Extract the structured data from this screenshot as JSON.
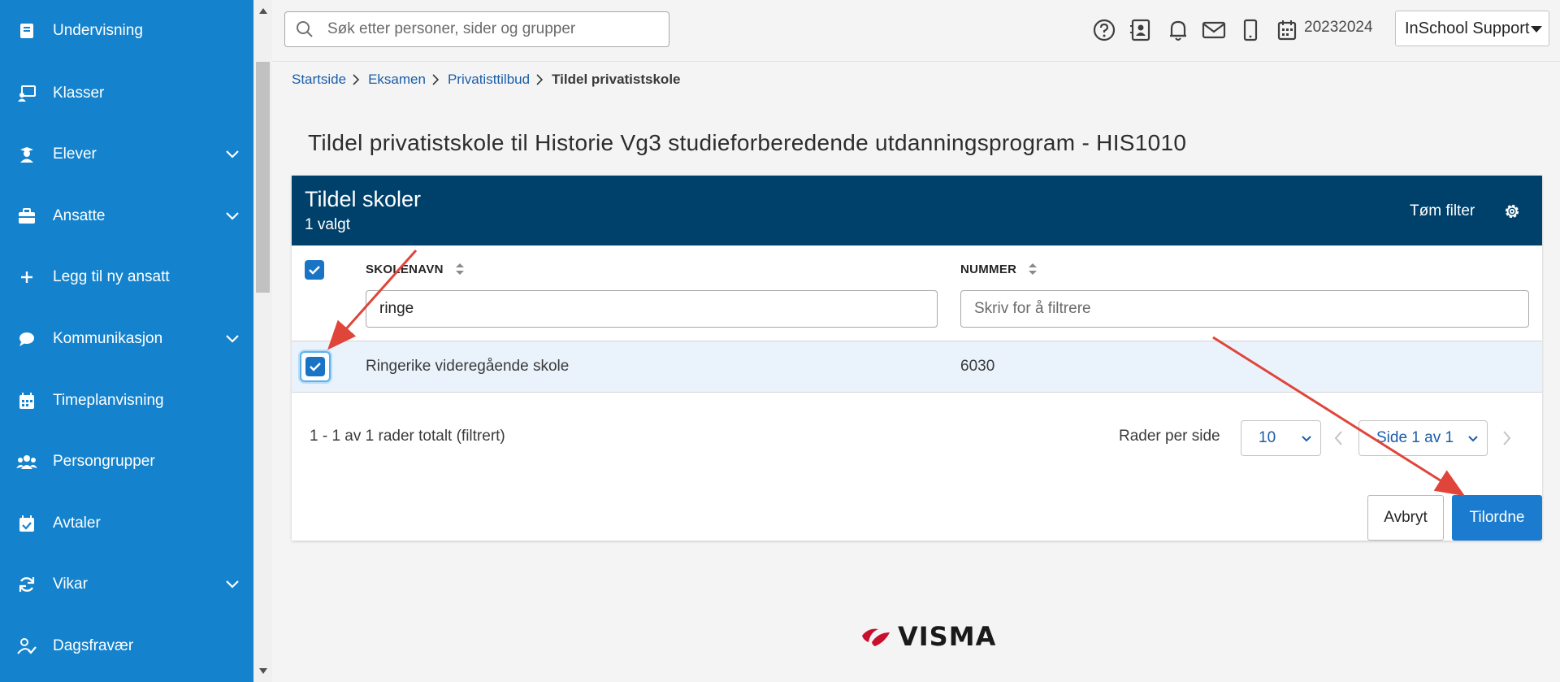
{
  "sidebar": {
    "items": [
      {
        "label": "Undervisning",
        "icon": "book-icon",
        "expandable": false
      },
      {
        "label": "Klasser",
        "icon": "teacher-board-icon",
        "expandable": false
      },
      {
        "label": "Elever",
        "icon": "student-icon",
        "expandable": true
      },
      {
        "label": "Ansatte",
        "icon": "briefcase-icon",
        "expandable": true
      },
      {
        "label": "Legg til ny ansatt",
        "icon": "plus-icon",
        "expandable": false
      },
      {
        "label": "Kommunikasjon",
        "icon": "chat-bubble-icon",
        "expandable": true
      },
      {
        "label": "Timeplanvisning",
        "icon": "calendar-icon",
        "expandable": false
      },
      {
        "label": "Persongrupper",
        "icon": "group-icon",
        "expandable": false
      },
      {
        "label": "Avtaler",
        "icon": "calendar-check-icon",
        "expandable": false
      },
      {
        "label": "Vikar",
        "icon": "refresh-icon",
        "expandable": true
      },
      {
        "label": "Dagsfravær",
        "icon": "user-check-icon",
        "expandable": false
      }
    ],
    "bg_color": "#1482cc"
  },
  "topbar": {
    "search_placeholder": "Søk etter personer, sider og grupper",
    "school_year": "20232024",
    "user_menu": "InSchool Support"
  },
  "breadcrumb": {
    "items": [
      "Startside",
      "Eksamen",
      "Privatisttilbud"
    ],
    "current": "Tildel privatistskole"
  },
  "page": {
    "title": "Tildel privatistskole til Historie Vg3 studieforberedende utdanningsprogram - HIS1010"
  },
  "card": {
    "title": "Tildel skoler",
    "subtitle": "1 valgt",
    "clear_filter": "Tøm filter",
    "header_color": "#00416b",
    "columns": [
      {
        "label": "SKOLENAVN",
        "filter_value": "ringe",
        "filter_placeholder": ""
      },
      {
        "label": "NUMMER",
        "filter_value": "",
        "filter_placeholder": "Skriv for å filtrere"
      }
    ],
    "rows": [
      {
        "school_name": "Ringerike videregående skole",
        "number": "6030",
        "checked": true
      }
    ],
    "summary": "1 - 1 av 1 rader totalt (filtrert)",
    "rows_per_page_label": "Rader per side",
    "rows_per_page": "10",
    "page_select": "Side 1 av 1",
    "cancel_label": "Avbryt",
    "assign_label": "Tilordne",
    "accent_color": "#1b7bcf"
  },
  "logo": {
    "text": "VISMA"
  },
  "annotation_color": "#e0453a"
}
